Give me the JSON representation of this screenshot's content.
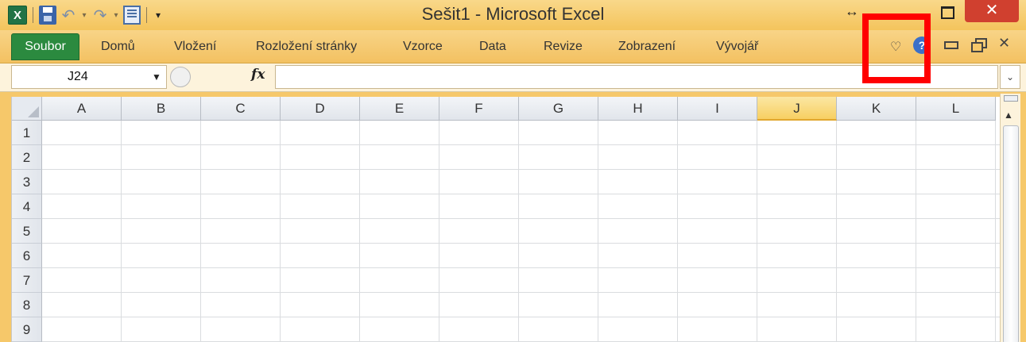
{
  "window": {
    "title": "Sešit1  -  Microsoft Excel",
    "close_glyph": "✕",
    "resize_glyph": "↔"
  },
  "qat": {
    "logo_letter": "X",
    "undo_glyph": "↶",
    "redo_glyph": "↷",
    "dropdown_glyph": "▾",
    "customize_glyph": "▾"
  },
  "ribbon": {
    "file_tab": "Soubor",
    "tabs": [
      "Domů",
      "Vložení",
      "Rozložení stránky",
      "Vzorce",
      "Data",
      "Revize",
      "Zobrazení",
      "Vývojář"
    ],
    "expand_glyph": "♡",
    "help_glyph": "?",
    "close_glyph": "✕"
  },
  "formula_bar": {
    "name_box": "J24",
    "name_box_dd": "▼",
    "fx": "fx",
    "expand_glyph": "⌄",
    "formula": ""
  },
  "sheet": {
    "columns": [
      "A",
      "B",
      "C",
      "D",
      "E",
      "F",
      "G",
      "H",
      "I",
      "J",
      "K",
      "L"
    ],
    "rows": [
      "1",
      "2",
      "3",
      "4",
      "5",
      "6",
      "7",
      "8",
      "9"
    ],
    "selected_column": "J"
  },
  "scrollbar": {
    "up_glyph": "▲"
  },
  "colors": {
    "chrome": "#f6c86a",
    "file_tab": "#2b8a3f",
    "close_button": "#d0402f",
    "highlight": "#ff0000",
    "selected_header": "#f7cf62"
  },
  "icons": [
    "excel-logo-icon",
    "save-icon",
    "undo-icon",
    "redo-icon",
    "form-icon",
    "ribbon-expand-icon",
    "help-icon",
    "minimize-icon",
    "restore-icon",
    "close-icon"
  ]
}
